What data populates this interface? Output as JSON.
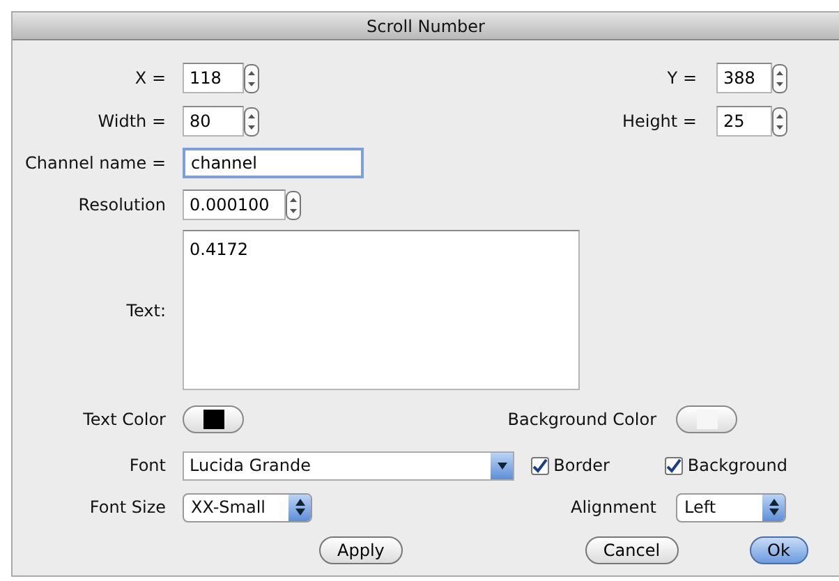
{
  "window": {
    "title": "Scroll Number"
  },
  "x": {
    "label": "X =",
    "value": "118"
  },
  "y": {
    "label": "Y =",
    "value": "388"
  },
  "width": {
    "label": "Width =",
    "value": "80"
  },
  "height": {
    "label": "Height =",
    "value": "25"
  },
  "channel_name": {
    "label": "Channel name =",
    "value": "channel",
    "focused": true
  },
  "resolution": {
    "label": "Resolution",
    "value": "0.000100"
  },
  "text": {
    "label": "Text:",
    "value": "0.4172"
  },
  "text_color": {
    "label": "Text Color",
    "color": "#000000"
  },
  "background_color": {
    "label": "Background Color",
    "color": "#f6f6f6"
  },
  "font": {
    "label": "Font",
    "value": "Lucida Grande"
  },
  "border": {
    "label": "Border",
    "checked": true
  },
  "background": {
    "label": "Background",
    "checked": true
  },
  "font_size": {
    "label": "Font Size",
    "value": "XX-Small"
  },
  "alignment": {
    "label": "Alignment",
    "value": "Left"
  },
  "buttons": [
    {
      "label": "Apply",
      "default": false
    },
    {
      "label": "Cancel",
      "default": false
    },
    {
      "label": "Ok",
      "default": true
    }
  ]
}
